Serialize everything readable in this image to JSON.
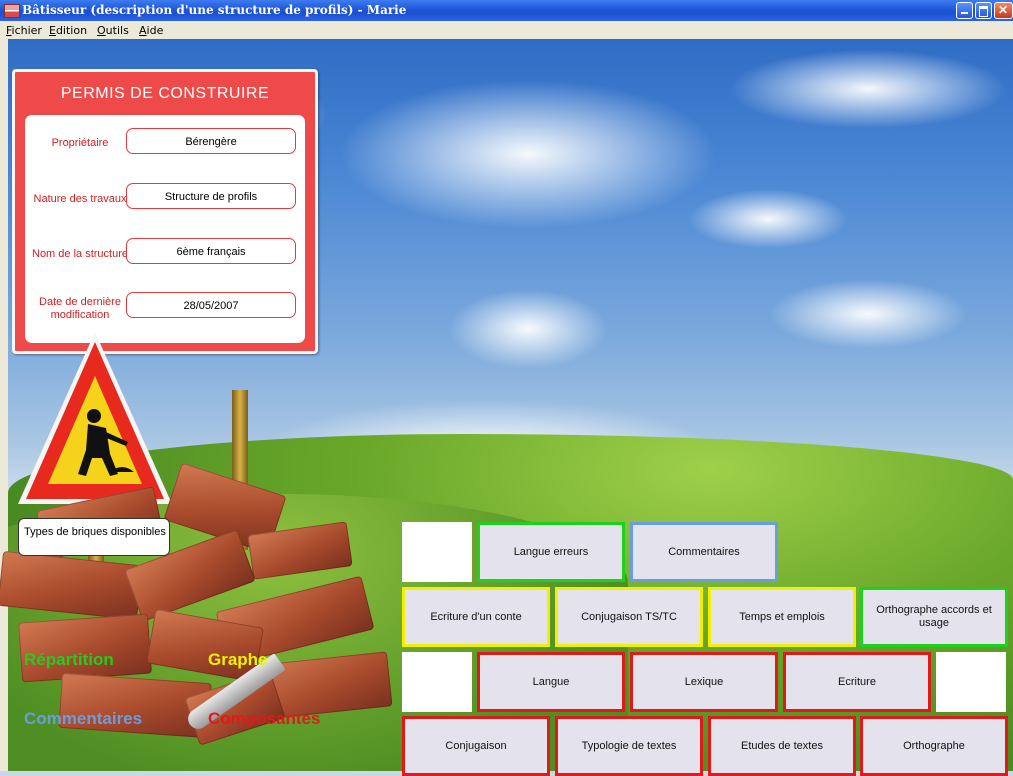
{
  "window": {
    "title": "Bâtisseur (description d'une structure de profils) - Marie"
  },
  "menu": {
    "items": [
      "Fichier",
      "Edition",
      "Outils",
      "Aide"
    ]
  },
  "permit": {
    "title": "PERMIS DE CONSTRUIRE",
    "fields": [
      {
        "label": "Propriétaire",
        "value": "Bérengère"
      },
      {
        "label": "Nature des travaux",
        "value": "Structure de profils"
      },
      {
        "label": "Nom de la structure",
        "value": "6ème français"
      },
      {
        "label": "Date de dernière modification",
        "value": "28/05/2007"
      }
    ]
  },
  "types_label": "Types de briques disponibles",
  "legend": {
    "repartition": {
      "label": "Répartition",
      "color": "#22cc22"
    },
    "graphe": {
      "label": "Graphe",
      "color": "#f0f000"
    },
    "commentaires": {
      "label": "Commentaires",
      "color": "#6a9de0"
    },
    "composantes": {
      "label": "Composantes",
      "color": "#e01a1a"
    }
  },
  "bricks": {
    "row1": [
      "Langue erreurs",
      "Commentaires"
    ],
    "row2": [
      "Ecriture d'un conte",
      "Conjugaison TS/TC",
      "Temps et emplois",
      "Orthographe accords et usage"
    ],
    "row3": [
      "Langue",
      "Lexique",
      "Ecriture"
    ],
    "row4": [
      "Conjugaison",
      "Typologie de textes",
      "Etudes de textes",
      "Orthographe"
    ]
  }
}
